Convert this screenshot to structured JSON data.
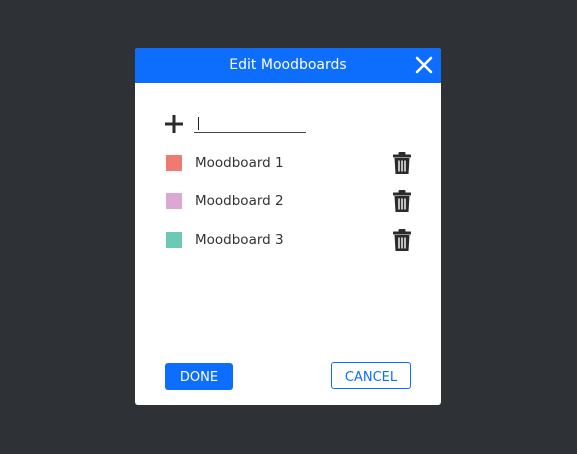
{
  "dialog": {
    "title": "Edit Moodboards",
    "close_icon": "close-icon"
  },
  "new_moodboard": {
    "add_icon": "plus-icon",
    "value": "",
    "placeholder": ""
  },
  "moodboards": [
    {
      "label": "Moodboard 1",
      "color": "#f07a71",
      "delete_icon": "trash-icon"
    },
    {
      "label": "Moodboard 2",
      "color": "#dba8d4",
      "delete_icon": "trash-icon"
    },
    {
      "label": "Moodboard 3",
      "color": "#6cc9b5",
      "delete_icon": "trash-icon"
    }
  ],
  "footer": {
    "done_label": "DONE",
    "cancel_label": "CANCEL"
  },
  "colors": {
    "accent": "#0d6efd",
    "backdrop": "#2e3135"
  }
}
